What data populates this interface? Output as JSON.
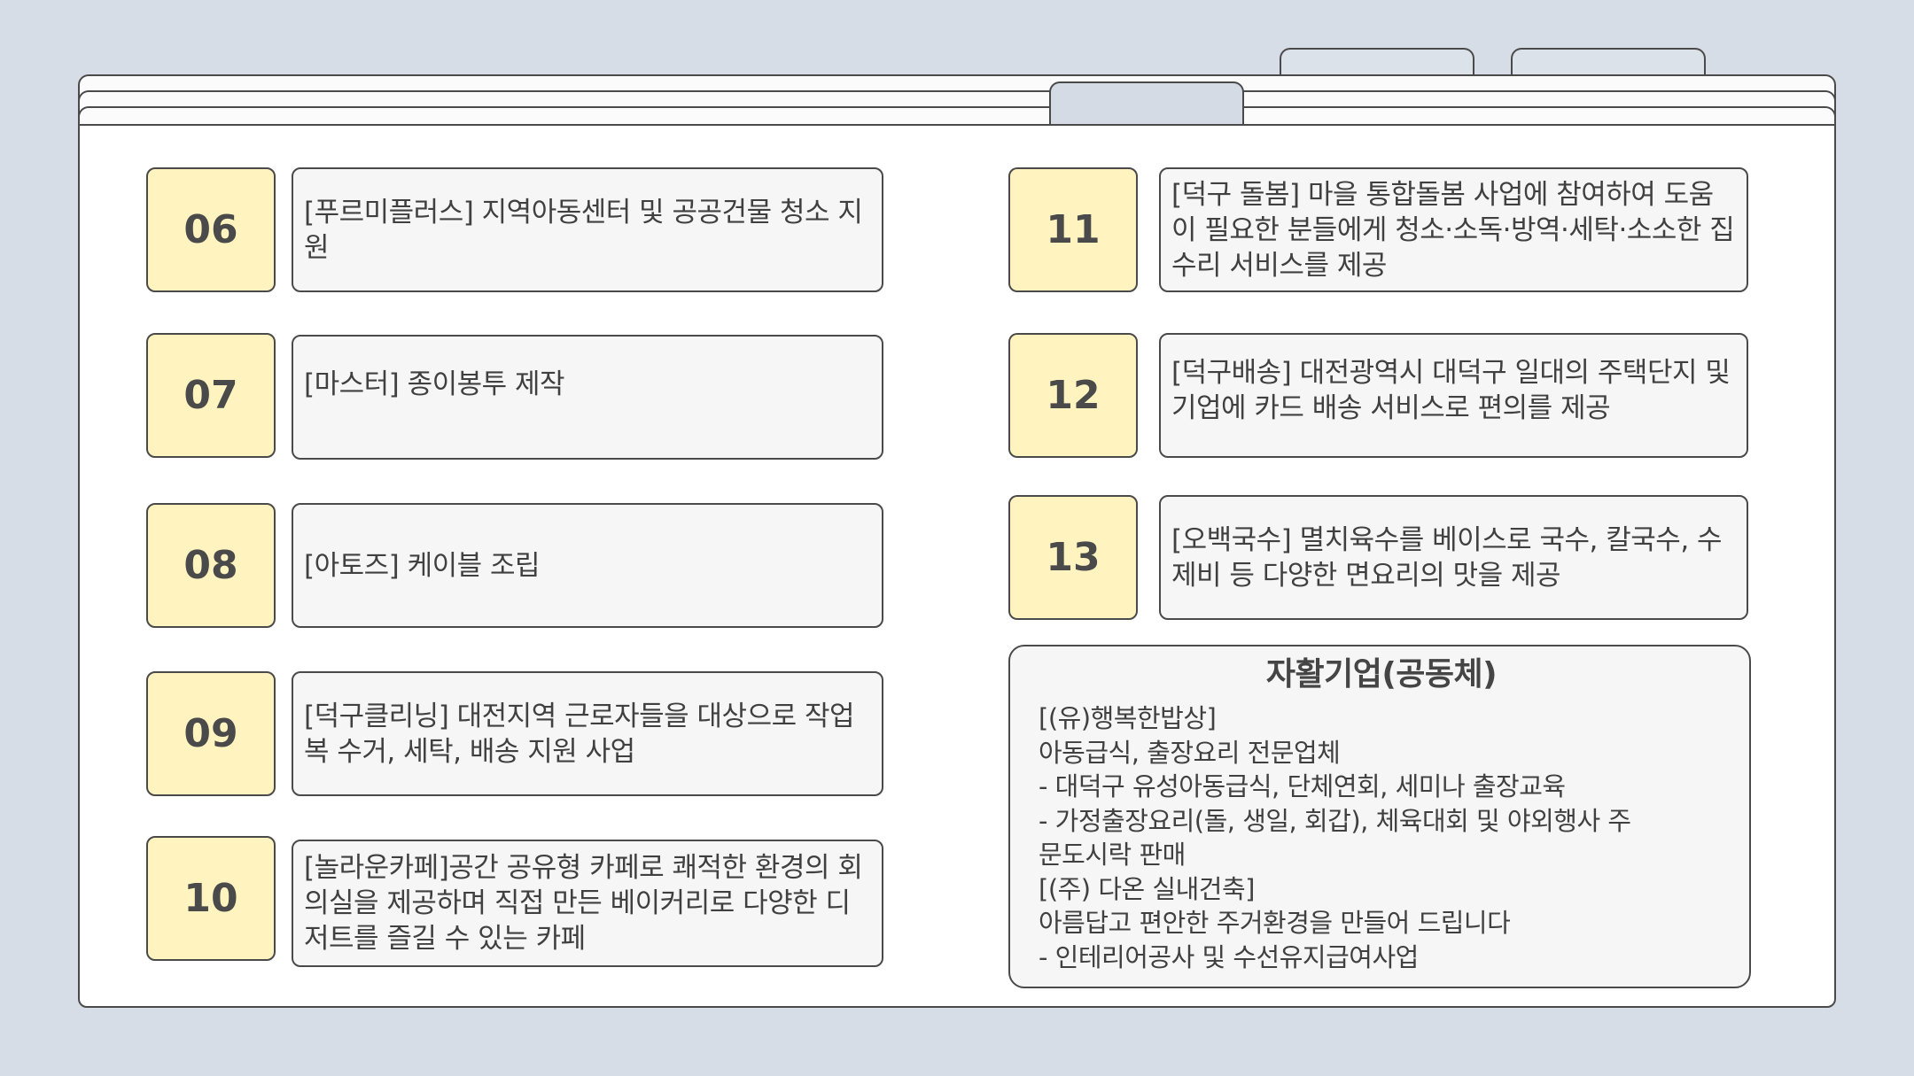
{
  "items_left": [
    {
      "num": "06",
      "text": "[푸르미플러스] 지역아동센터 및 공공건물 청소 지원"
    },
    {
      "num": "07",
      "text": "[마스터] 종이봉투 제작"
    },
    {
      "num": "08",
      "text": "[아토즈] 케이블 조립"
    },
    {
      "num": "09",
      "text": "[덕구클리닝] 대전지역 근로자들을 대상으로 작업복 수거, 세탁, 배송 지원 사업"
    },
    {
      "num": "10",
      "text": "[놀라운카페]공간 공유형 카페로 쾌적한 환경의 회의실을 제공하며 직접 만든 베이커리로 다양한 디저트를 즐길 수 있는 카페"
    }
  ],
  "items_right": [
    {
      "num": "11",
      "text": "[덕구 돌봄] 마을 통합돌봄 사업에 참여하여 도움이 필요한 분들에게 청소·소독·방역·세탁·소소한 집수리 서비스를 제공"
    },
    {
      "num": "12",
      "text": "[덕구배송] 대전광역시 대덕구 일대의 주택단지 및 기업에 카드 배송 서비스로 편의를 제공"
    },
    {
      "num": "13",
      "text": "[오백국수] 멸치육수를 베이스로 국수, 칼국수, 수제비 등 다양한 면요리의 맛을 제공"
    }
  ],
  "info_box": {
    "title": "자활기업(공동체)",
    "lines": [
      "[(유)행복한밥상]",
      "아동급식, 출장요리 전문업체",
      "- 대덕구 유성아동급식, 단체연회, 세미나 출장교육",
      "- 가정출장요리(돌, 생일, 회갑), 체육대회 및 야외행사 주",
      "문도시락 판매",
      "[(주) 다온 실내건축]",
      "아름답고 편안한 주거환경을 만들어 드립니다",
      "- 인테리어공사 및 수선유지급여사업"
    ]
  },
  "colors": {
    "background": "#d6dde6",
    "number_fill": "#fff4c0",
    "box_fill": "#f6f6f6",
    "outline": "#4a4a4a"
  }
}
